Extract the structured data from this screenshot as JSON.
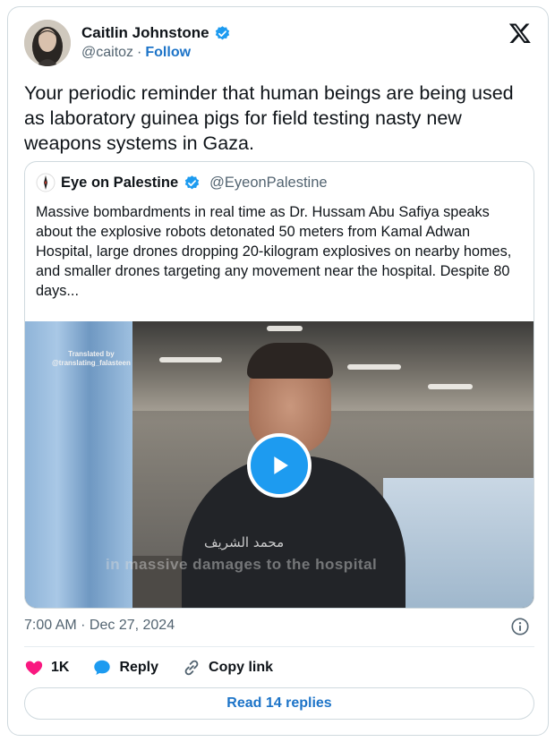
{
  "author": {
    "name": "Caitlin Johnstone",
    "handle": "@caitoz",
    "separator": "·",
    "follow_label": "Follow",
    "verified": true
  },
  "tweet": {
    "text": "Your periodic reminder that human beings are being used as laboratory guinea pigs for field testing nasty new weapons systems in Gaza.",
    "timestamp": "7:00 AM · Dec 27, 2024"
  },
  "quoted": {
    "name": "Eye on Palestine",
    "handle": "@EyeonPalestine",
    "verified": true,
    "text": "Massive bombardments in real time as Dr. Hussam Abu Safiya speaks about the explosive robots detonated 50 meters from Kamal Adwan Hospital, large drones dropping 20-kilogram explosives on nearby homes, and smaller drones targeting any movement near the hospital. Despite 80 days..."
  },
  "video": {
    "watermark_line1": "Translated by",
    "watermark_line2": "@translating_falasteen",
    "caption_arabic": "محمد الشريف",
    "caption_english": "in massive damages to the hospital"
  },
  "actions": {
    "like_count": "1K",
    "reply_label": "Reply",
    "copy_link_label": "Copy link"
  },
  "read_replies_label": "Read 14 replies",
  "colors": {
    "accent": "#1d9bf0",
    "link": "#1d74c8",
    "like": "#f91880",
    "muted": "#536471",
    "border": "#cfd9de"
  },
  "icons": {
    "close": "x-logo-icon",
    "verified": "verified-badge-icon",
    "play": "play-icon",
    "info": "info-icon",
    "like": "heart-icon",
    "reply": "reply-bubble-icon",
    "copy": "link-icon"
  }
}
